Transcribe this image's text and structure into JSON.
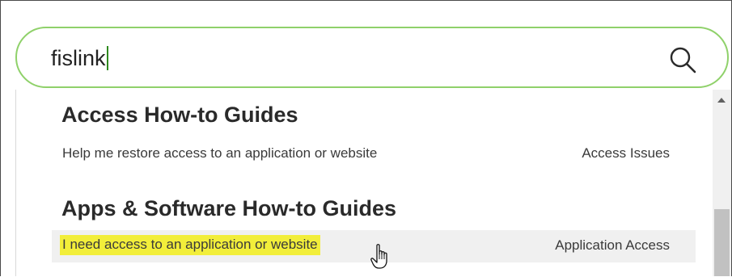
{
  "search": {
    "value": "fislink"
  },
  "icons": {
    "search": "search-icon",
    "cursor": "hand-pointer-cursor"
  },
  "colors": {
    "search_border": "#8fd16a",
    "highlight": "#f2ee3a",
    "hover_row": "#f0f0f0"
  },
  "results": {
    "groups": [
      {
        "heading": "Access How-to Guides",
        "items": [
          {
            "title": "Help me restore access to an application or website",
            "category": "Access Issues",
            "hovered": false
          }
        ]
      },
      {
        "heading": "Apps & Software How-to Guides",
        "items": [
          {
            "title": "I need access to an application or website",
            "category": "Application Access",
            "hovered": true
          }
        ]
      }
    ]
  }
}
